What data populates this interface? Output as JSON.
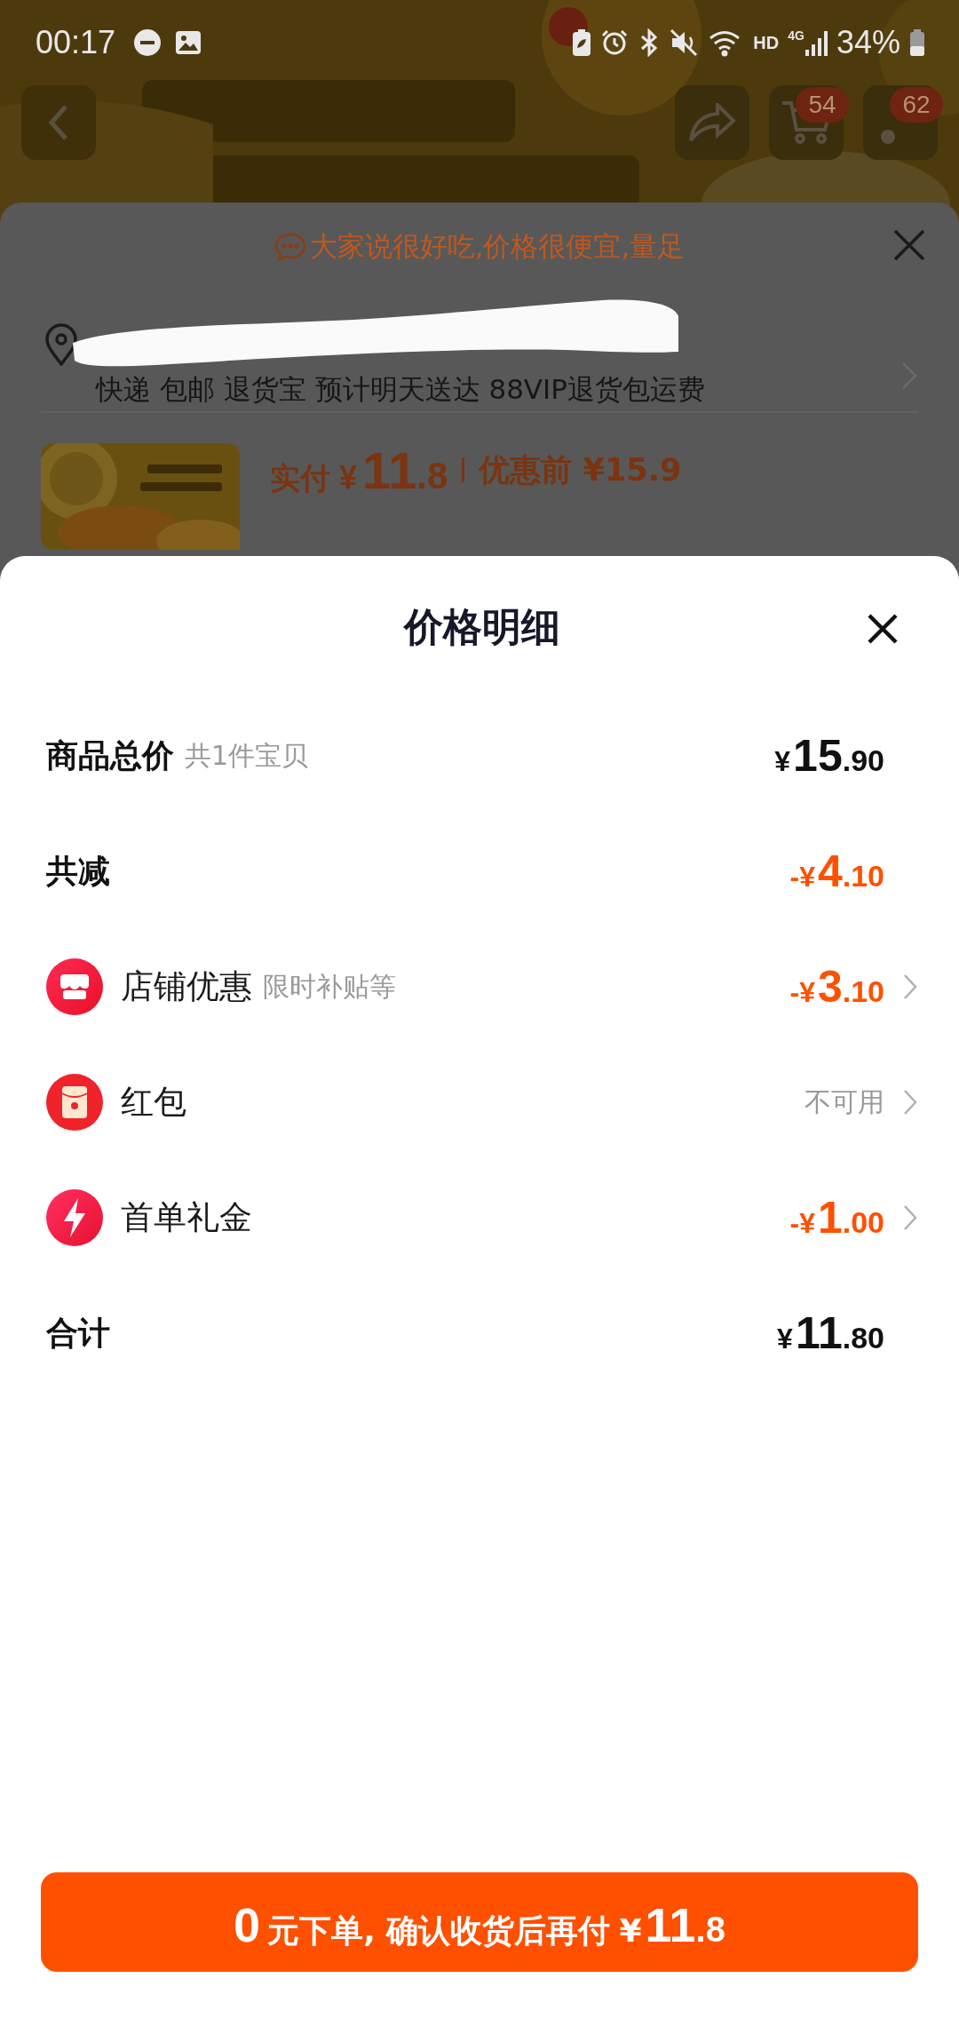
{
  "status_bar": {
    "time": "00:17",
    "network": "HD",
    "cellular": "4G",
    "battery": "34%"
  },
  "nav_buttons": [
    {
      "kind": "back"
    },
    {
      "kind": "share"
    },
    {
      "kind": "cart",
      "badge": "54"
    },
    {
      "kind": "other",
      "badge": "62"
    }
  ],
  "order_summary": {
    "tip": "大家说很好吃,价格很便宜,量足",
    "delivery": "快递 包邮 退货宝 预计明天送达 88VIP退货包运费",
    "price": {
      "label": "实付",
      "currency": "¥",
      "main": "11",
      "fraction": ".8"
    },
    "original_price": "优惠前 ¥15.9"
  },
  "price_detail": {
    "title": "价格明细",
    "rows": [
      {
        "kind": "summary",
        "label": "商品总价",
        "note": "共1件宝贝",
        "highlight": false,
        "amount": {
          "prefix": "¥",
          "main": "15",
          "fraction": ".90"
        }
      },
      {
        "kind": "summary",
        "label": "共减",
        "highlight": true,
        "amount": {
          "prefix": "-¥",
          "main": "4",
          "fraction": ".10"
        }
      },
      {
        "kind": "store",
        "label": "店铺优惠",
        "note": "限时补贴等",
        "highlight": true,
        "amount": {
          "prefix": "-¥",
          "main": "3",
          "fraction": ".10"
        }
      },
      {
        "kind": "packet",
        "label": "红包",
        "status": "不可用"
      },
      {
        "kind": "bolt",
        "label": "首单礼金",
        "highlight": true,
        "amount": {
          "prefix": "-¥",
          "main": "1",
          "fraction": ".00"
        }
      },
      {
        "kind": "summary",
        "label": "合计",
        "highlight": false,
        "amount": {
          "prefix": "¥",
          "main": "11",
          "fraction": ".80"
        }
      }
    ]
  },
  "order_button": {
    "lead": "0",
    "text": "元下单, 确认收货后再付",
    "currency": "¥",
    "main": "11",
    "fraction": ".8"
  }
}
